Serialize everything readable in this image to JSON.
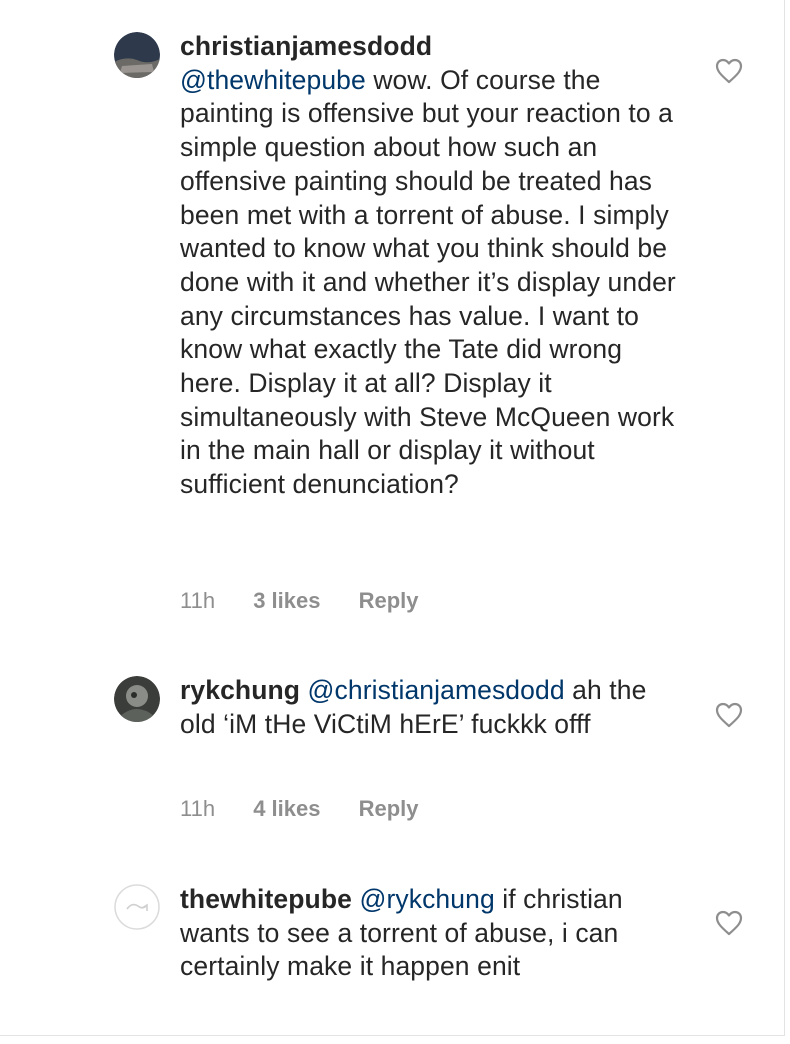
{
  "comments": [
    {
      "username": "christianjamesdodd",
      "mention": "@thewhitepube",
      "text": " wow. Of course the painting is offensive but your reaction to a simple question about how such an offensive painting should be treated has been met with a torrent of abuse. I simply wanted to know what you think should be done with it and whether it’s display under any circumstances has value. I want to know what exactly the Tate did wrong here. Display it at all? Display it simultaneously with Steve McQueen work in the main hall or display it without sufficient denunciation?",
      "time": "11h",
      "likes": "3 likes",
      "reply_label": "Reply",
      "icon": "heart-outline-icon"
    },
    {
      "username": "rykchung",
      "mention": "@christianjamesdodd",
      "text": " ah the old ‘iM tHe ViCtiM hErE’ fuckkk offf",
      "time": "11h",
      "likes": "4 likes",
      "reply_label": "Reply",
      "icon": "heart-outline-icon"
    },
    {
      "username": "thewhitepube",
      "mention": "@rykchung",
      "text": " if christian wants to see a torrent of abuse, i can certainly make it happen enit",
      "icon": "heart-outline-icon"
    }
  ],
  "colors": {
    "text": "#262626",
    "mention": "#00376b",
    "meta": "#8e8e8e",
    "heart": "#8e8e8e"
  }
}
